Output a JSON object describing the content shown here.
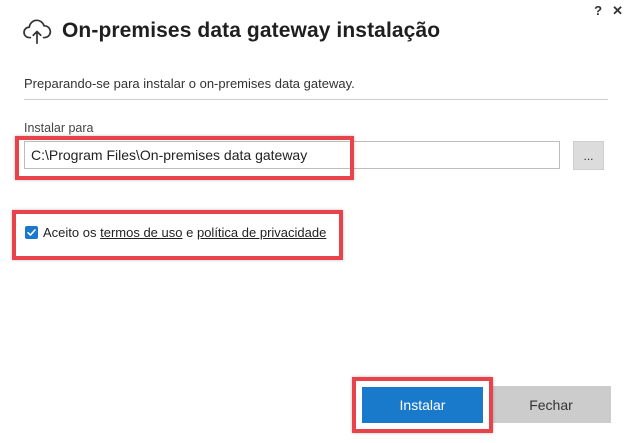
{
  "window": {
    "help_label": "?",
    "close_label": "✕",
    "icon": "cloud-upload-icon"
  },
  "header": {
    "title": "On-premises data gateway instalação"
  },
  "status": {
    "text": "Preparando-se para instalar o on-premises data gateway."
  },
  "install_path": {
    "label": "Instalar para",
    "value": "C:\\Program Files\\On-premises data gateway",
    "browse_label": "..."
  },
  "terms": {
    "checked": true,
    "prefix": "Aceito os",
    "terms_link": "termos de uso",
    "conjunction": "e",
    "privacy_link": "política de privacidade"
  },
  "buttons": {
    "install": "Instalar",
    "close": "Fechar"
  },
  "colors": {
    "accent": "#1979ca",
    "highlight": "#e8434a",
    "secondary_button": "#cccccc"
  }
}
